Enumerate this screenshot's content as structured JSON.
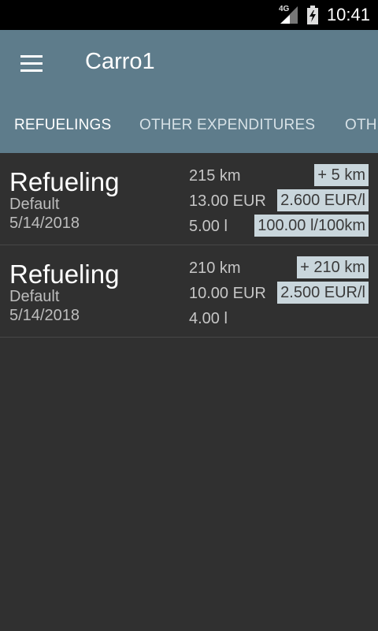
{
  "status_bar": {
    "network": "4G",
    "time": "10:41"
  },
  "app_bar": {
    "title": "Carro1"
  },
  "tabs": [
    {
      "label": "REFUELINGS"
    },
    {
      "label": "OTHER EXPENDITURES"
    },
    {
      "label": "OTH"
    }
  ],
  "entries": [
    {
      "title": "Refueling",
      "category": "Default",
      "date": "5/14/2018",
      "odometer": "215 km",
      "distance_diff": "+ 5 km",
      "cost": "13.00 EUR",
      "price_per_unit": "2.600 EUR/l",
      "volume": "5.00 l",
      "consumption": "100.00 l/100km"
    },
    {
      "title": "Refueling",
      "category": "Default",
      "date": "5/14/2018",
      "odometer": "210 km",
      "distance_diff": "+ 210 km",
      "cost": "10.00 EUR",
      "price_per_unit": "2.500 EUR/l",
      "volume": "4.00 l",
      "consumption": ""
    }
  ]
}
